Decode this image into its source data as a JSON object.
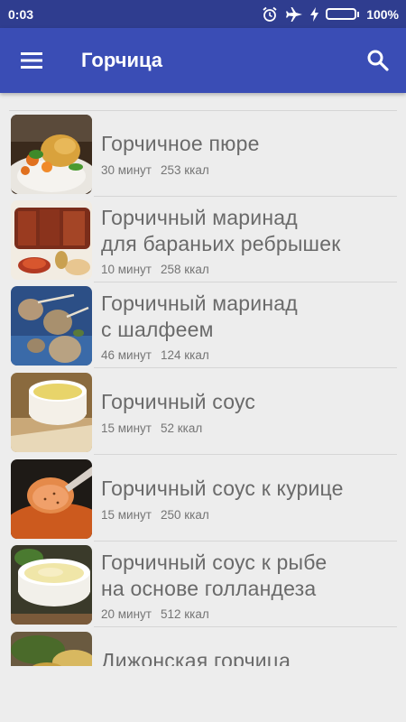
{
  "status_bar": {
    "time": "0:03",
    "battery_percent": "100%",
    "battery_level": 1.0,
    "icons": [
      "alarm-icon",
      "airplane-icon",
      "charging-icon",
      "battery-icon"
    ]
  },
  "app_bar": {
    "title": "Горчица",
    "menu_icon": "menu-icon",
    "search_icon": "search-icon"
  },
  "recipes": [
    {
      "title": "Горчичное пюре",
      "time": "30 минут",
      "kcal": "253 ккал"
    },
    {
      "title": "Горчичный маринад\nдля бараньих ребрышек",
      "time": "10 минут",
      "kcal": "258 ккал"
    },
    {
      "title": "Горчичный маринад\nс шалфеем",
      "time": "46 минут",
      "kcal": "124 ккал"
    },
    {
      "title": "Горчичный соус",
      "time": "15 минут",
      "kcal": "52 ккал"
    },
    {
      "title": "Горчичный соус к курице",
      "time": "15 минут",
      "kcal": "250 ккал"
    },
    {
      "title": "Горчичный соус к рыбе\nна основе голландеза",
      "time": "20 минут",
      "kcal": "512 ккал"
    },
    {
      "title": "Дижонская горчица",
      "time": "",
      "kcal": ""
    }
  ],
  "colors": {
    "status_bar": "#2f3d8f",
    "app_bar": "#3a4db5",
    "background": "#ededed"
  }
}
